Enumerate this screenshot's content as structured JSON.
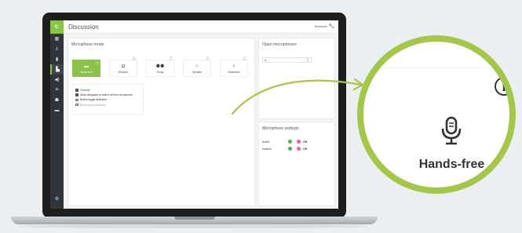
{
  "app": {
    "logo": "t:",
    "title": "Discussion",
    "user": "Technician",
    "user_icon": "wrench-icon"
  },
  "sidebar": {
    "items": [
      {
        "icon": "dashboard-icon",
        "glyph": "▦"
      },
      {
        "icon": "network-icon",
        "glyph": "⅄"
      },
      {
        "icon": "device-icon",
        "glyph": "▮"
      },
      {
        "icon": "discussion-icon",
        "glyph": "▙"
      },
      {
        "icon": "volume-icon",
        "glyph": "◀)"
      },
      {
        "icon": "participants-icon",
        "glyph": "≗"
      },
      {
        "icon": "seats-icon",
        "glyph": "☗"
      },
      {
        "icon": "document-icon",
        "glyph": "▬"
      }
    ],
    "settings_icon": "gear-icon"
  },
  "microphone_mode": {
    "title": "Microphone mode",
    "modes": [
      {
        "label": "Hands-free",
        "icon": "chat-icon",
        "glyph": "▬",
        "selected": true
      },
      {
        "label": "Request",
        "icon": "message-icon",
        "glyph": "◘",
        "selected": false
      },
      {
        "label": "Group",
        "icon": "group-icon",
        "glyph": "⚉⚉",
        "selected": false
      },
      {
        "label": "Operator",
        "icon": "headphones-icon",
        "glyph": "∩",
        "selected": false
      },
      {
        "label": "Handsfree",
        "icon": "microphone-icon",
        "glyph": "♀",
        "selected": false
      }
    ],
    "options": {
      "override": "Override",
      "allow_switch_off": "Allow delegates to switch off their microphone",
      "button_toggle": "Button toggle activation",
      "button_push": "Button push activation"
    }
  },
  "open_microphones": {
    "title": "Open microphones",
    "value": "4"
  },
  "microphone_settings": {
    "title": "Microphone settings",
    "rows": [
      {
        "label": "Active",
        "state": "Off"
      },
      {
        "label": "Inactive",
        "state": "Off"
      }
    ],
    "colors": {
      "on": "#4caf50",
      "off": "#f06292"
    }
  },
  "zoom": {
    "label": "Hands-free",
    "icon": "microphone-icon",
    "info_icon": "info-icon",
    "info_glyph": "i"
  },
  "colors": {
    "accent": "#8bc34a",
    "sidebar": "#30353b",
    "zoom_ring": "#a4c64a"
  }
}
